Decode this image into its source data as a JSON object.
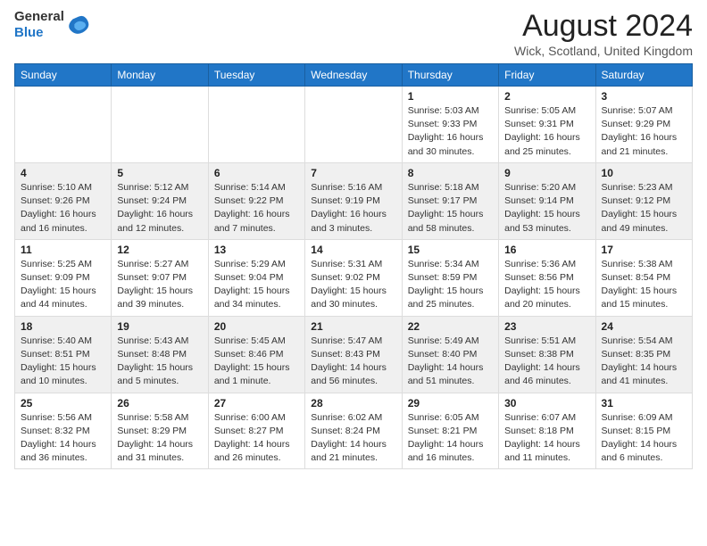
{
  "header": {
    "logo": {
      "line1": "General",
      "line2": "Blue"
    },
    "title": "August 2024",
    "location": "Wick, Scotland, United Kingdom"
  },
  "days_of_week": [
    "Sunday",
    "Monday",
    "Tuesday",
    "Wednesday",
    "Thursday",
    "Friday",
    "Saturday"
  ],
  "weeks": [
    [
      {
        "day": "",
        "info": ""
      },
      {
        "day": "",
        "info": ""
      },
      {
        "day": "",
        "info": ""
      },
      {
        "day": "",
        "info": ""
      },
      {
        "day": "1",
        "info": "Sunrise: 5:03 AM\nSunset: 9:33 PM\nDaylight: 16 hours\nand 30 minutes."
      },
      {
        "day": "2",
        "info": "Sunrise: 5:05 AM\nSunset: 9:31 PM\nDaylight: 16 hours\nand 25 minutes."
      },
      {
        "day": "3",
        "info": "Sunrise: 5:07 AM\nSunset: 9:29 PM\nDaylight: 16 hours\nand 21 minutes."
      }
    ],
    [
      {
        "day": "4",
        "info": "Sunrise: 5:10 AM\nSunset: 9:26 PM\nDaylight: 16 hours\nand 16 minutes."
      },
      {
        "day": "5",
        "info": "Sunrise: 5:12 AM\nSunset: 9:24 PM\nDaylight: 16 hours\nand 12 minutes."
      },
      {
        "day": "6",
        "info": "Sunrise: 5:14 AM\nSunset: 9:22 PM\nDaylight: 16 hours\nand 7 minutes."
      },
      {
        "day": "7",
        "info": "Sunrise: 5:16 AM\nSunset: 9:19 PM\nDaylight: 16 hours\nand 3 minutes."
      },
      {
        "day": "8",
        "info": "Sunrise: 5:18 AM\nSunset: 9:17 PM\nDaylight: 15 hours\nand 58 minutes."
      },
      {
        "day": "9",
        "info": "Sunrise: 5:20 AM\nSunset: 9:14 PM\nDaylight: 15 hours\nand 53 minutes."
      },
      {
        "day": "10",
        "info": "Sunrise: 5:23 AM\nSunset: 9:12 PM\nDaylight: 15 hours\nand 49 minutes."
      }
    ],
    [
      {
        "day": "11",
        "info": "Sunrise: 5:25 AM\nSunset: 9:09 PM\nDaylight: 15 hours\nand 44 minutes."
      },
      {
        "day": "12",
        "info": "Sunrise: 5:27 AM\nSunset: 9:07 PM\nDaylight: 15 hours\nand 39 minutes."
      },
      {
        "day": "13",
        "info": "Sunrise: 5:29 AM\nSunset: 9:04 PM\nDaylight: 15 hours\nand 34 minutes."
      },
      {
        "day": "14",
        "info": "Sunrise: 5:31 AM\nSunset: 9:02 PM\nDaylight: 15 hours\nand 30 minutes."
      },
      {
        "day": "15",
        "info": "Sunrise: 5:34 AM\nSunset: 8:59 PM\nDaylight: 15 hours\nand 25 minutes."
      },
      {
        "day": "16",
        "info": "Sunrise: 5:36 AM\nSunset: 8:56 PM\nDaylight: 15 hours\nand 20 minutes."
      },
      {
        "day": "17",
        "info": "Sunrise: 5:38 AM\nSunset: 8:54 PM\nDaylight: 15 hours\nand 15 minutes."
      }
    ],
    [
      {
        "day": "18",
        "info": "Sunrise: 5:40 AM\nSunset: 8:51 PM\nDaylight: 15 hours\nand 10 minutes."
      },
      {
        "day": "19",
        "info": "Sunrise: 5:43 AM\nSunset: 8:48 PM\nDaylight: 15 hours\nand 5 minutes."
      },
      {
        "day": "20",
        "info": "Sunrise: 5:45 AM\nSunset: 8:46 PM\nDaylight: 15 hours\nand 1 minute."
      },
      {
        "day": "21",
        "info": "Sunrise: 5:47 AM\nSunset: 8:43 PM\nDaylight: 14 hours\nand 56 minutes."
      },
      {
        "day": "22",
        "info": "Sunrise: 5:49 AM\nSunset: 8:40 PM\nDaylight: 14 hours\nand 51 minutes."
      },
      {
        "day": "23",
        "info": "Sunrise: 5:51 AM\nSunset: 8:38 PM\nDaylight: 14 hours\nand 46 minutes."
      },
      {
        "day": "24",
        "info": "Sunrise: 5:54 AM\nSunset: 8:35 PM\nDaylight: 14 hours\nand 41 minutes."
      }
    ],
    [
      {
        "day": "25",
        "info": "Sunrise: 5:56 AM\nSunset: 8:32 PM\nDaylight: 14 hours\nand 36 minutes."
      },
      {
        "day": "26",
        "info": "Sunrise: 5:58 AM\nSunset: 8:29 PM\nDaylight: 14 hours\nand 31 minutes."
      },
      {
        "day": "27",
        "info": "Sunrise: 6:00 AM\nSunset: 8:27 PM\nDaylight: 14 hours\nand 26 minutes."
      },
      {
        "day": "28",
        "info": "Sunrise: 6:02 AM\nSunset: 8:24 PM\nDaylight: 14 hours\nand 21 minutes."
      },
      {
        "day": "29",
        "info": "Sunrise: 6:05 AM\nSunset: 8:21 PM\nDaylight: 14 hours\nand 16 minutes."
      },
      {
        "day": "30",
        "info": "Sunrise: 6:07 AM\nSunset: 8:18 PM\nDaylight: 14 hours\nand 11 minutes."
      },
      {
        "day": "31",
        "info": "Sunrise: 6:09 AM\nSunset: 8:15 PM\nDaylight: 14 hours\nand 6 minutes."
      }
    ]
  ]
}
